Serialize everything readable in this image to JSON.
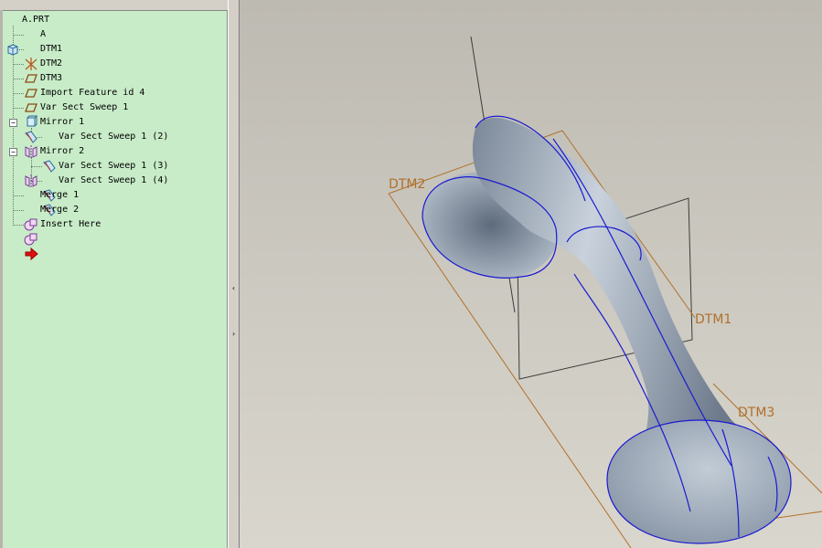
{
  "model_tree": {
    "root_label": "A.PRT",
    "items": [
      {
        "label": "A",
        "icon": "csys-icon"
      },
      {
        "label": "DTM1",
        "icon": "datum-plane-icon"
      },
      {
        "label": "DTM2",
        "icon": "datum-plane-icon"
      },
      {
        "label": "DTM3",
        "icon": "datum-plane-icon"
      },
      {
        "label": "Import Feature id 4",
        "icon": "import-feature-icon"
      },
      {
        "label": "Var Sect Sweep 1",
        "icon": "sweep-icon"
      },
      {
        "label": "Mirror 1",
        "icon": "mirror-icon",
        "expander": "−"
      },
      {
        "label": "Var Sect Sweep 1 (2)",
        "icon": "sweep-icon"
      },
      {
        "label": "Mirror 2",
        "icon": "mirror-icon",
        "expander": "−"
      },
      {
        "label": "Var Sect Sweep 1 (3)",
        "icon": "sweep-icon"
      },
      {
        "label": "Var Sect Sweep 1 (4)",
        "icon": "sweep-icon"
      },
      {
        "label": "Merge 1",
        "icon": "merge-icon"
      },
      {
        "label": "Merge 2",
        "icon": "merge-icon"
      },
      {
        "label": "Insert Here",
        "icon": "insert-here-arrow-icon"
      }
    ]
  },
  "splitter": {
    "collapse_glyph": "‹",
    "expand_glyph": "›"
  },
  "viewport": {
    "datum_labels": {
      "dtm1": "DTM1",
      "dtm2": "DTM2",
      "dtm3": "DTM3"
    },
    "colors": {
      "datum": "#b0702a",
      "edge": "#1a1ad0",
      "surface": "#9aa6b6",
      "background": "#c8c5bd"
    }
  }
}
